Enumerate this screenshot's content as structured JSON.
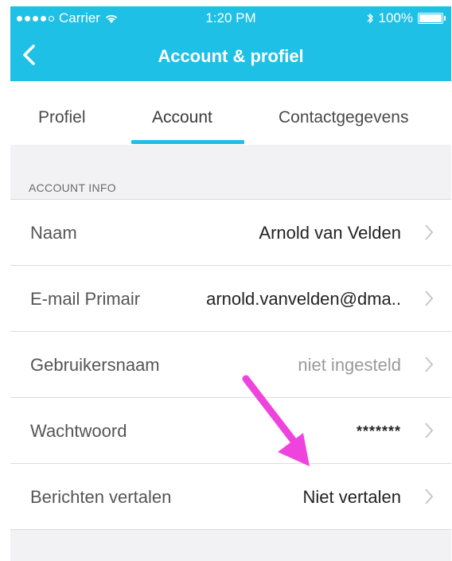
{
  "status": {
    "carrier": "Carrier",
    "time": "1:20 PM",
    "battery": "100%",
    "battery_level": 1.0
  },
  "nav": {
    "title": "Account & profiel"
  },
  "tabs": [
    {
      "label": "Profiel",
      "active": false
    },
    {
      "label": "Account",
      "active": true
    },
    {
      "label": "Contactgegevens",
      "active": false
    }
  ],
  "section": {
    "header": "ACCOUNT INFO"
  },
  "rows": [
    {
      "label": "Naam",
      "value": "Arnold van Velden"
    },
    {
      "label": "E-mail Primair",
      "value": "arnold.vanvelden@dma.."
    },
    {
      "label": "Gebruikersnaam",
      "value": "niet ingesteld"
    },
    {
      "label": "Wachtwoord",
      "value": "*******"
    },
    {
      "label": "Berichten vertalen",
      "value": "Niet vertalen"
    }
  ],
  "colors": {
    "accent": "#1ec0e6",
    "annotation_arrow": "#ee44dd"
  },
  "icons": [
    "back-chevron-icon",
    "wifi-icon",
    "bluetooth-icon",
    "battery-icon",
    "chevron-right-icon",
    "annotation-arrow-icon"
  ]
}
